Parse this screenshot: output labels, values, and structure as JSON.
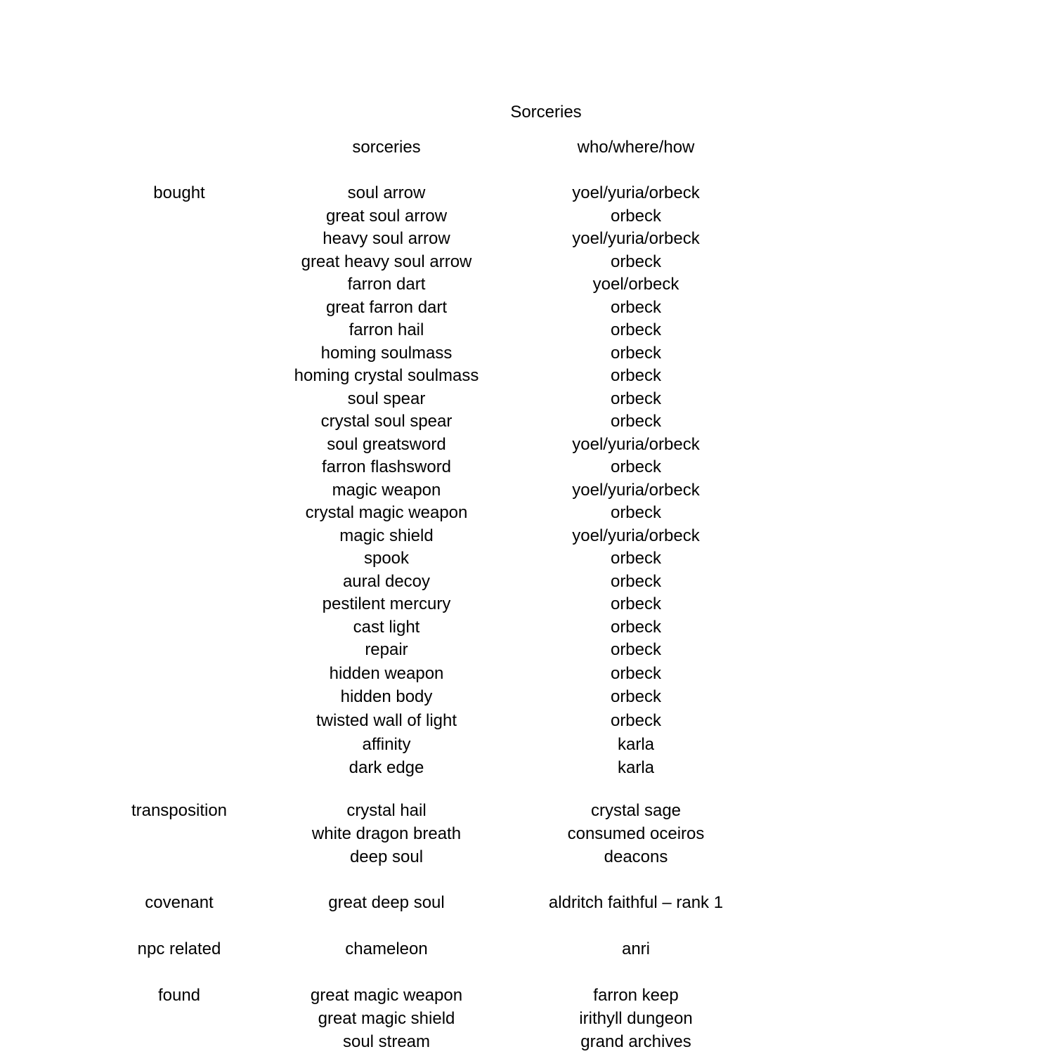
{
  "document": {
    "title": "Sorceries",
    "headers": {
      "category": "",
      "spell": "sorceries",
      "source": "who/where/how"
    },
    "groups": [
      {
        "category": "bought",
        "rows": [
          {
            "spell": "soul arrow",
            "source": "yoel/yuria/orbeck"
          },
          {
            "spell": "great soul arrow",
            "source": "orbeck"
          },
          {
            "spell": "heavy soul arrow",
            "source": "yoel/yuria/orbeck"
          },
          {
            "spell": "great heavy soul arrow",
            "source": "orbeck"
          },
          {
            "spell": "farron dart",
            "source": "yoel/orbeck"
          },
          {
            "spell": "great farron dart",
            "source": "orbeck"
          },
          {
            "spell": "farron hail",
            "source": "orbeck"
          },
          {
            "spell": "homing soulmass",
            "source": "orbeck"
          },
          {
            "spell": "homing crystal soulmass",
            "source": "orbeck"
          },
          {
            "spell": "soul spear",
            "source": "orbeck"
          },
          {
            "spell": "crystal soul spear",
            "source": "orbeck"
          },
          {
            "spell": "soul greatsword",
            "source": "yoel/yuria/orbeck"
          },
          {
            "spell": "farron flashsword",
            "source": "orbeck"
          },
          {
            "spell": "magic weapon",
            "source": "yoel/yuria/orbeck"
          },
          {
            "spell": "crystal magic weapon",
            "source": "orbeck"
          },
          {
            "spell": "magic shield",
            "source": "yoel/yuria/orbeck"
          },
          {
            "spell": "spook",
            "source": "orbeck"
          },
          {
            "spell": "aural decoy",
            "source": "orbeck"
          },
          {
            "spell": "pestilent mercury",
            "source": "orbeck"
          },
          {
            "spell": "cast light",
            "source": "orbeck"
          },
          {
            "spell": "repair",
            "source": "orbeck"
          },
          {
            "spell": "hidden weapon",
            "source": "orbeck"
          },
          {
            "spell": "hidden body",
            "source": "orbeck"
          },
          {
            "spell": "twisted wall of light",
            "source": "orbeck"
          },
          {
            "spell": "affinity",
            "source": "karla"
          },
          {
            "spell": "dark edge",
            "source": "karla"
          }
        ]
      },
      {
        "category": "transposition",
        "rows": [
          {
            "spell": "crystal hail",
            "source": "crystal sage"
          },
          {
            "spell": "white dragon breath",
            "source": "consumed oceiros"
          },
          {
            "spell": "deep soul",
            "source": "deacons"
          }
        ]
      },
      {
        "category": "covenant",
        "rows": [
          {
            "spell": "great deep soul",
            "source": "aldritch faithful – rank 1"
          }
        ]
      },
      {
        "category": "npc related",
        "rows": [
          {
            "spell": "chameleon",
            "source": "anri"
          }
        ]
      },
      {
        "category": "found",
        "rows": [
          {
            "spell": "great magic weapon",
            "source": "farron keep"
          },
          {
            "spell": "great magic shield",
            "source": "irithyll dungeon"
          },
          {
            "spell": "soul stream",
            "source": "grand archives"
          }
        ]
      }
    ]
  }
}
